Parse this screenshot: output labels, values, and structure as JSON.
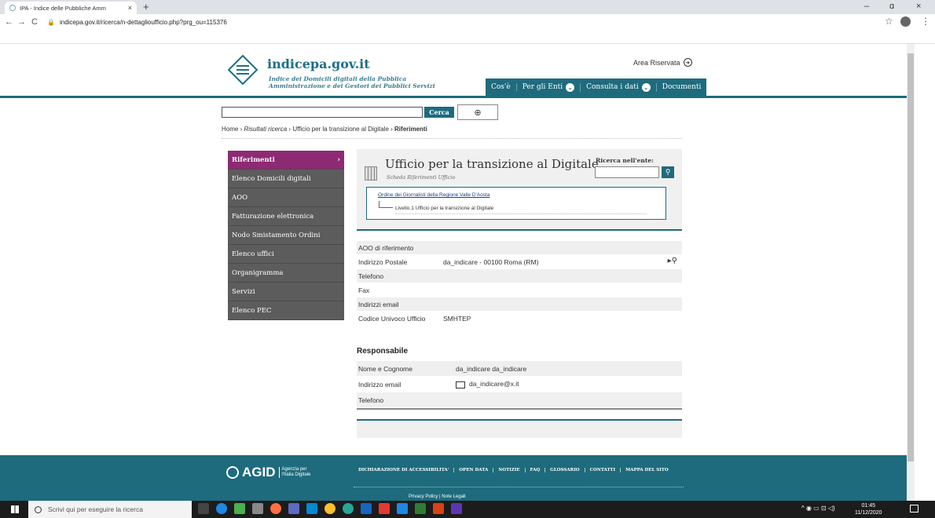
{
  "browser": {
    "tab_title": "IPA - Indice delle Pubbliche Amm",
    "tab_close": "×",
    "new_tab": "+",
    "win_min": "–",
    "win_max": "ɑ",
    "win_close": "×",
    "back": "←",
    "forward": "→",
    "reload": "C",
    "lock": "🔒",
    "url": "indicepa.gov.it/ricerca/n-dettaglioufficio.php?prg_ou=115376",
    "star": "☆",
    "menu": "⋮"
  },
  "header": {
    "brand": "indicepa.gov.it",
    "tagline_1": "Indice dei Domicili digitali della Pubblica",
    "tagline_2": "Amministrazione e dei Gestori dei Pubblici Servizi",
    "area_riservata": "Area Riservata",
    "nav": [
      {
        "label": "Cos'è",
        "chevron": false
      },
      {
        "label": "Per gli Enti",
        "chevron": true
      },
      {
        "label": "Consulta i dati",
        "chevron": true
      },
      {
        "label": "Documenti",
        "chevron": false
      }
    ]
  },
  "search": {
    "button": "Cerca",
    "placeholder": ""
  },
  "breadcrumb": {
    "home": "Home",
    "sep": "›",
    "results": "Risultati ricerca",
    "office": "Ufficio per la transizione al Digitale",
    "current": "Riferimenti"
  },
  "sidebar": {
    "items": [
      {
        "label": "Riferimenti",
        "active": true
      },
      {
        "label": "Elenco Domicili digitali"
      },
      {
        "label": "AOO"
      },
      {
        "label": "Fatturazione elettronica"
      },
      {
        "label": "Nodo Smistamento Ordini"
      },
      {
        "label": "Elenco uffici"
      },
      {
        "label": "Organigramma"
      },
      {
        "label": "Servizi"
      },
      {
        "label": "Elenco PEC"
      }
    ]
  },
  "panel": {
    "title": "Ufficio per la transizione al Digitale",
    "subtitle": "Scheda Riferimenti Ufficio",
    "ricerca_label": "Ricerca nell'ente:",
    "tree_org": "Ordine dei Giornalisti della Regione Valle D'Aosta",
    "tree_level": "Livello.1 Ufficio per la transizione al Digitale"
  },
  "details": [
    {
      "label": "AOO di riferimento",
      "value": ""
    },
    {
      "label": "Indirizzo Postale",
      "value": "da_indicare - 00100 Roma (RM)"
    },
    {
      "label": "Telefono",
      "value": ""
    },
    {
      "label": "Fax",
      "value": ""
    },
    {
      "label": "Indirizzi email",
      "value": ""
    },
    {
      "label": "Codice Univoco Ufficio",
      "value": "SMHTEP"
    }
  ],
  "responsabile": {
    "title": "Responsabile",
    "rows": [
      {
        "label": "Nome e Cognome",
        "value": "da_indicare da_indicare"
      },
      {
        "label": "Indirizzo email",
        "value": "da_indicare@x.it"
      },
      {
        "label": "Telefono",
        "value": ""
      }
    ]
  },
  "footer": {
    "agid": "AGID",
    "agid_sub_1": "Agenzia per",
    "agid_sub_2": "l'Italia Digitale",
    "links": [
      "DICHIARAZIONE DI ACCESSIBILITA'",
      "OPEN DATA",
      "NOTIZIE",
      "FAQ",
      "GLOSSARIO",
      "CONTATTI",
      "MAPPA DEL SITO"
    ],
    "sub": "Privacy Policy | Note Legali"
  },
  "taskbar": {
    "search_placeholder": "Scrivi qui per eseguire la ricerca",
    "time": "01:45",
    "date": "11/12/2020"
  }
}
